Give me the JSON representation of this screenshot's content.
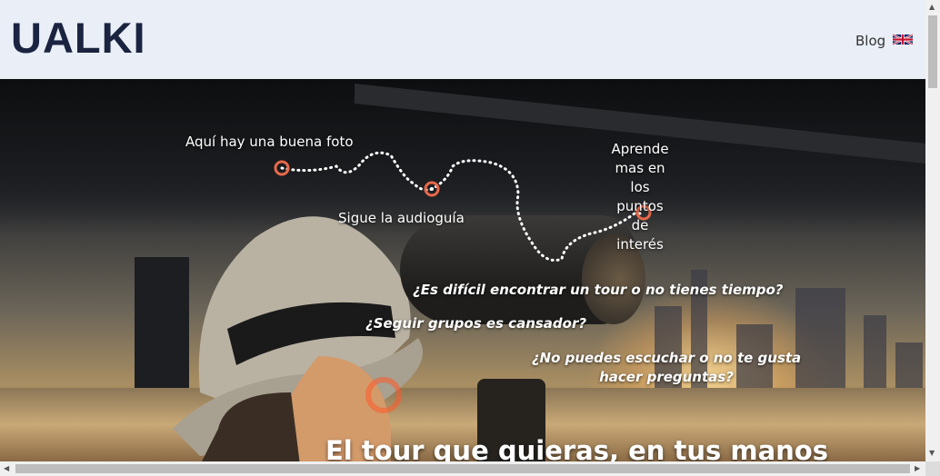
{
  "header": {
    "logo_text": "UALKI",
    "nav": {
      "blog_label": "Blog"
    },
    "language_icon": "uk-flag-icon"
  },
  "hero": {
    "path_labels": {
      "photo": "Aquí hay una buena foto",
      "audio": "Sigue la audioguía",
      "learn": "Aprende mas en los puntos de interés"
    },
    "questions": [
      "¿Es difícil encontrar un tour o no tienes tiempo?",
      "¿Seguir grupos es cansador?",
      "¿No puedes escuchar o no te gusta hacer preguntas?"
    ],
    "headline": "El tour que quieras, en tus manos"
  },
  "colors": {
    "header_bg": "#e9eef7",
    "logo": "#1a2440",
    "marker": "#e8694a"
  }
}
